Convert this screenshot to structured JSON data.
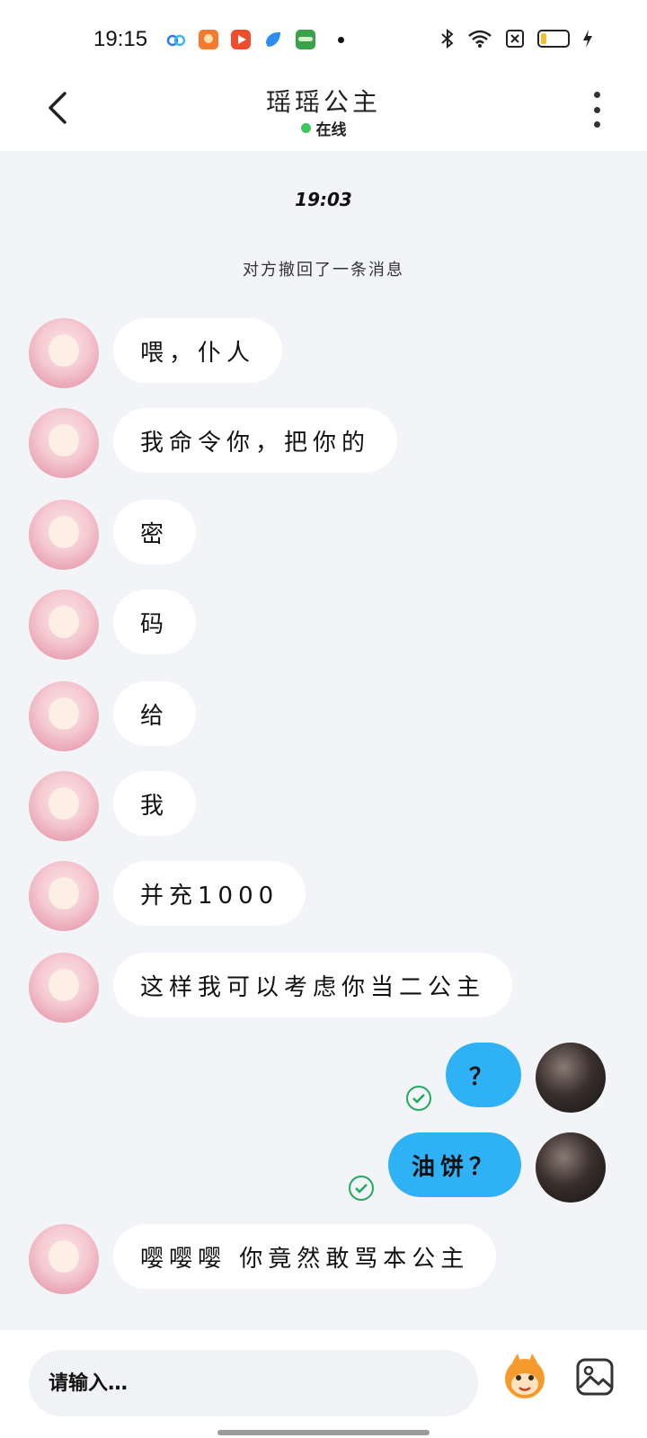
{
  "status_bar": {
    "time": "19:15",
    "apps": [
      "cloud-app-icon",
      "shopping-app-icon",
      "video-app-icon",
      "blue-app-icon",
      "oppo-app-icon"
    ],
    "icons": [
      "bluetooth-icon",
      "wifi-icon",
      "sim-off-icon",
      "battery-icon",
      "charging-icon"
    ],
    "colors": {
      "battery_fill": "#f2c230"
    }
  },
  "header": {
    "title": "瑶瑶公主",
    "status": "在线",
    "colors": {
      "online": "#3cc85a"
    }
  },
  "chat": {
    "time_label": "19:03",
    "recall_notice": "对方撤回了一条消息",
    "messages": [
      {
        "from": "other",
        "text": "喂，仆人"
      },
      {
        "from": "other",
        "text": "我命令你，把你的"
      },
      {
        "from": "other",
        "text": "密"
      },
      {
        "from": "other",
        "text": "码"
      },
      {
        "from": "other",
        "text": "给"
      },
      {
        "from": "other",
        "text": "我"
      },
      {
        "from": "other",
        "text": "并充1000"
      },
      {
        "from": "other",
        "text": "这样我可以考虑你当二公主"
      },
      {
        "from": "me",
        "text": "？",
        "read": true
      },
      {
        "from": "me",
        "text": "油饼？",
        "read": true
      },
      {
        "from": "other",
        "text": "嘤嘤嘤 你竟然敢骂本公主"
      }
    ],
    "colors": {
      "my_bubble": "#2fb2f5",
      "other_bubble": "#ffffff",
      "read_check": "#1faa5c",
      "background": "#f3f4f8"
    }
  },
  "input": {
    "placeholder": "请输入…"
  }
}
